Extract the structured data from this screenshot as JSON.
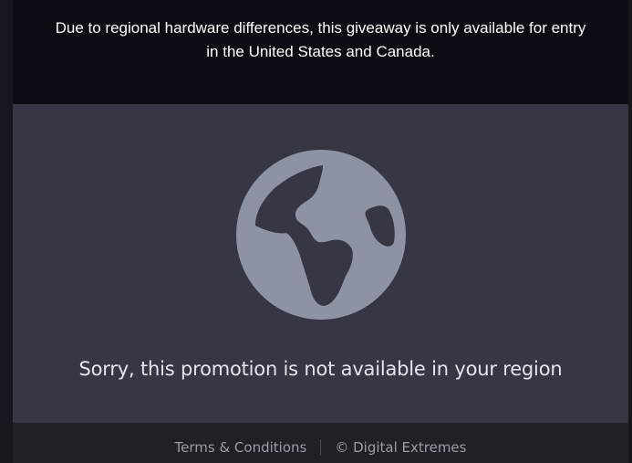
{
  "notice": {
    "line1": "Due to regional hardware differences, this giveaway is only available for entry",
    "line2": "in the United States and Canada."
  },
  "panel": {
    "icon": "globe-icon",
    "message": "Sorry, this promotion is not available in your region"
  },
  "footer": {
    "terms_label": "Terms & Conditions",
    "copyright": "© Digital Extremes"
  },
  "colors": {
    "notice_bg": "#0b0d14",
    "panel_bg": "#353745",
    "globe": "#8e93a4",
    "footer_bg": "#1f2127"
  }
}
